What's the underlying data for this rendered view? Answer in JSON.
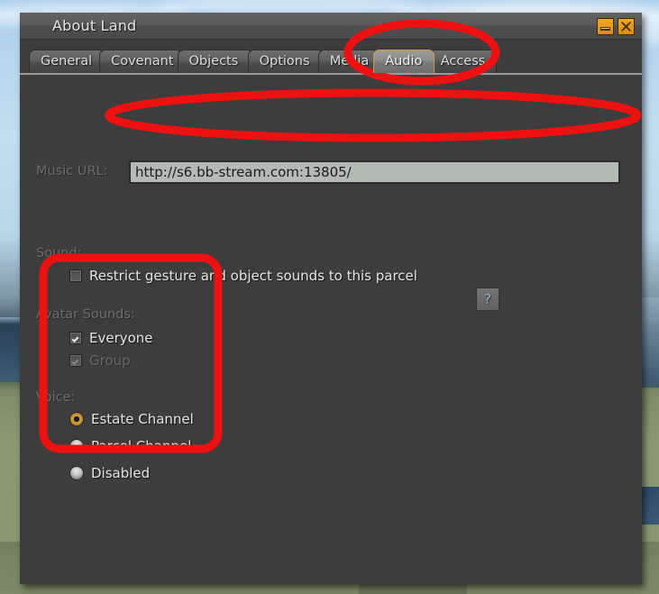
{
  "window": {
    "title": "About Land",
    "controls": [
      {
        "name": "minimize-button",
        "icon": "minimize-icon"
      },
      {
        "name": "close-button",
        "icon": "close-icon"
      }
    ]
  },
  "tabs": [
    {
      "label": "General",
      "selected": false
    },
    {
      "label": "Covenant",
      "selected": false
    },
    {
      "label": "Objects",
      "selected": false
    },
    {
      "label": "Options",
      "selected": false
    },
    {
      "label": "Media",
      "selected": false
    },
    {
      "label": "Audio",
      "selected": true
    },
    {
      "label": "Access",
      "selected": false
    }
  ],
  "panel": {
    "music_url": {
      "label": "Music URL:",
      "value": "http://s6.bb-stream.com:13805/",
      "placeholder": ""
    },
    "sound": {
      "label": "Sound:",
      "restrict": {
        "label": "Restrict gesture and object sounds to this parcel",
        "checked": false
      },
      "help_label": "?"
    },
    "avatar_sounds": {
      "label": "Avatar Sounds:",
      "options": [
        {
          "label": "Everyone",
          "checked": true,
          "enabled": true
        },
        {
          "label": "Group",
          "checked": true,
          "enabled": false
        }
      ]
    },
    "voice": {
      "label": "Voice:",
      "options": [
        {
          "label": "Estate Channel",
          "selected": true
        },
        {
          "label": "Parcel Channel",
          "selected": false
        },
        {
          "label": "Disabled",
          "selected": false
        }
      ]
    }
  },
  "annotation": {
    "color": "#ee1111",
    "shapes": [
      {
        "name": "annotation-oval-tabs",
        "type": "ellipse"
      },
      {
        "name": "annotation-oval-music-url",
        "type": "ellipse"
      },
      {
        "name": "annotation-rect-audio-options",
        "type": "rounded-rect"
      }
    ]
  }
}
